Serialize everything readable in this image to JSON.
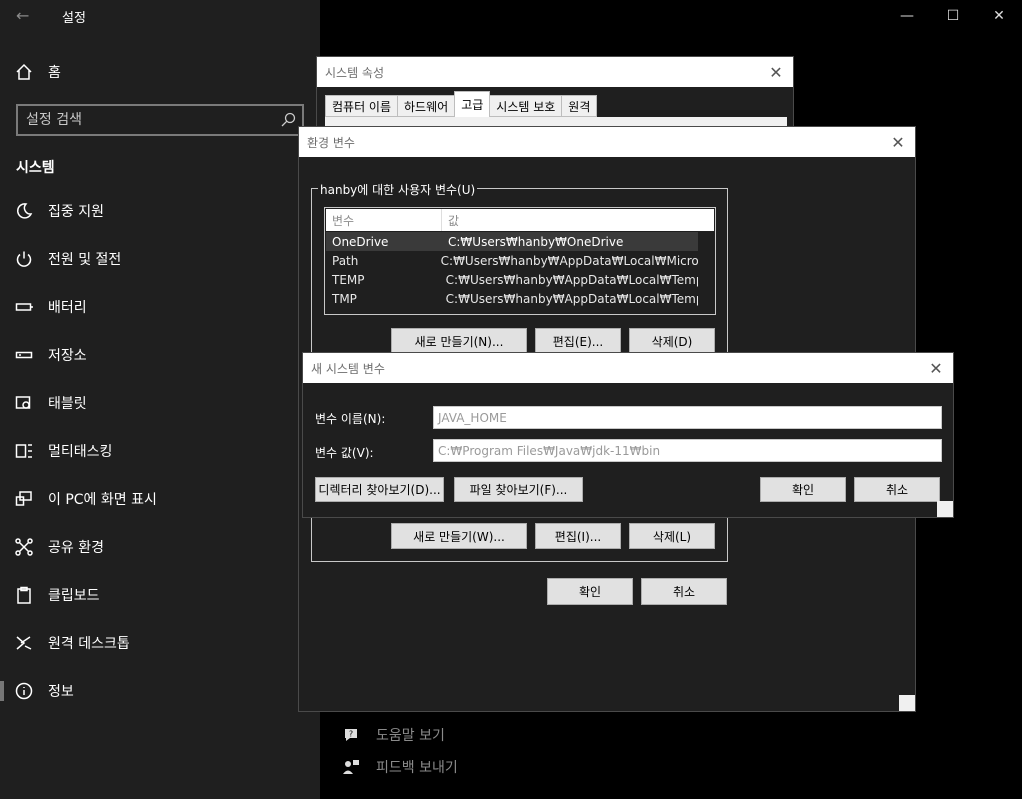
{
  "settings": {
    "title": "설정",
    "home": "홈",
    "search_placeholder": "설정 검색",
    "section": "시스템",
    "nav": [
      {
        "label": "집중 지원",
        "icon": "moon-icon"
      },
      {
        "label": "전원 및 절전",
        "icon": "power-icon"
      },
      {
        "label": "배터리",
        "icon": "battery-icon"
      },
      {
        "label": "저장소",
        "icon": "storage-icon"
      },
      {
        "label": "태블릿",
        "icon": "tablet-icon"
      },
      {
        "label": "멀티태스킹",
        "icon": "multitasking-icon"
      },
      {
        "label": "이 PC에 화면 표시",
        "icon": "project-icon"
      },
      {
        "label": "공유 환경",
        "icon": "shared-icon"
      },
      {
        "label": "클립보드",
        "icon": "clipboard-icon"
      },
      {
        "label": "원격 데스크톱",
        "icon": "remote-desktop-icon"
      },
      {
        "label": "정보",
        "icon": "info-icon"
      }
    ],
    "help": "도움말 보기",
    "feedback": "피드백 보내기"
  },
  "system_properties": {
    "title": "시스템 속성",
    "tabs": [
      "컴퓨터 이름",
      "하드웨어",
      "고급",
      "시스템 보호",
      "원격"
    ],
    "selected_tab": "고급"
  },
  "env_vars": {
    "title": "환경 변수",
    "user_group": "hanby에 대한 사용자 변수(U)",
    "columns": [
      "변수",
      "값"
    ],
    "rows": [
      {
        "name": "OneDrive",
        "value": "C:₩Users₩hanby₩OneDrive"
      },
      {
        "name": "Path",
        "value": "C:₩Users₩hanby₩AppData₩Local₩Micros..."
      },
      {
        "name": "TEMP",
        "value": "C:₩Users₩hanby₩AppData₩Local₩Temp"
      },
      {
        "name": "TMP",
        "value": "C:₩Users₩hanby₩AppData₩Local₩Temp"
      }
    ],
    "user_new": "새로 만들기(N)...",
    "user_edit": "편집(E)...",
    "user_delete": "삭제(D)",
    "sys_new": "새로 만들기(W)...",
    "sys_edit": "편집(I)...",
    "sys_delete": "삭제(L)",
    "ok": "확인",
    "cancel": "취소"
  },
  "new_var": {
    "title": "새 시스템 변수",
    "name_label": "변수 이름(N):",
    "name_value": "JAVA_HOME",
    "value_label": "변수 값(V):",
    "value_value": "C:₩Program Files₩Java₩jdk-11₩bin",
    "browse_dir": "디렉터리 찾아보기(D)...",
    "browse_file": "파일 찾아보기(F)...",
    "ok": "확인",
    "cancel": "취소"
  }
}
